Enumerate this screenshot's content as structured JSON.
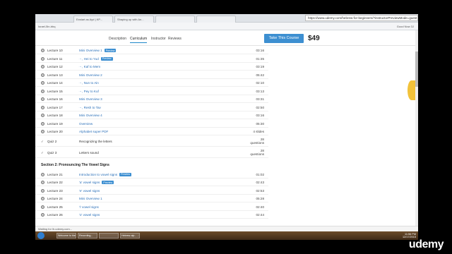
{
  "browser": {
    "address": "https://www.udemy.com/hebrew-for-beginners/?instructorPreviewMode=guest",
    "tabs": [
      "Exstart as Ayd | KP...",
      "Shaping up with An...",
      "",
      ""
    ],
    "bookmarks": [
      "Israel-5in-bbq",
      "",
      "",
      "Good Now 3J"
    ]
  },
  "header": {
    "tabs": [
      "Description",
      "Curriculum",
      "Instructor",
      "Reviews"
    ],
    "take_button": "Take This Course",
    "price": "$49"
  },
  "lectures": [
    {
      "num": "Lecture 10",
      "title": "Mini Overview 1",
      "preview": "Preview",
      "dur": "03:16"
    },
    {
      "num": "Lecture 11",
      "title": "ּ - ּ, Hei to Yud",
      "preview": "Preview",
      "dur": "01:35"
    },
    {
      "num": "Lecture 12",
      "title": "ּ - ּ, Kaf to Mem",
      "preview": "",
      "dur": "03:19"
    },
    {
      "num": "Lecture 13",
      "title": "Mini Overview 2",
      "preview": "",
      "dur": "05:42"
    },
    {
      "num": "Lecture 14",
      "title": "ּ - ּ, Nun to Ain",
      "preview": "",
      "dur": "02:10"
    },
    {
      "num": "Lecture 15",
      "title": "ּ - ּ, Pey to Kuf",
      "preview": "",
      "dur": "03:13"
    },
    {
      "num": "Lecture 16",
      "title": "Mini Overview 3",
      "preview": "",
      "dur": "03:31"
    },
    {
      "num": "Lecture 17",
      "title": "ּ - ּ, Resh to Tav",
      "preview": "",
      "dur": "02:50"
    },
    {
      "num": "Lecture 18",
      "title": "Mini Overview 4",
      "preview": "",
      "dur": "03:16"
    },
    {
      "num": "Lecture 19",
      "title": "Overview",
      "preview": "",
      "dur": "05:30"
    },
    {
      "num": "Lecture 20",
      "title": "Alphabet super PDF",
      "preview": "",
      "dur": "4 slides"
    }
  ],
  "quizzes": [
    {
      "num": "Quiz 2",
      "title": "Recognizing the letters",
      "count": "28",
      "unit": "questions"
    },
    {
      "num": "Quiz 3",
      "title": "Letters sound",
      "count": "28",
      "unit": "questions"
    }
  ],
  "section2": {
    "title": "Section 2: Pronouncing The Vowel Signs",
    "lectures": [
      {
        "num": "Lecture 21",
        "title": "Introduction to vowel signs",
        "preview": "Preview",
        "dur": "01:02"
      },
      {
        "num": "Lecture 22",
        "title": "'a' vowel signs",
        "preview": "Preview",
        "dur": "02:43"
      },
      {
        "num": "Lecture 23",
        "title": "'e' vowel signs",
        "preview": "",
        "dur": "02:53"
      },
      {
        "num": "Lecture 24",
        "title": "Mini Overview 1",
        "preview": "",
        "dur": "05:28"
      },
      {
        "num": "Lecture 25",
        "title": "'i' vowel signs",
        "preview": "",
        "dur": "02:40"
      },
      {
        "num": "Lecture 26",
        "title": "'o' vowel signs",
        "preview": "",
        "dur": "02:44"
      }
    ]
  },
  "status_text": "Waiting for lh.udemy.com...",
  "taskbar": {
    "items": [
      "Welcome to the Hebr...",
      "Recording...",
      "",
      "Hebrew-alp... - Micros..."
    ],
    "clock_time": "11:56 PM",
    "clock_date": "12/17/2015"
  },
  "watermark": "udemy"
}
